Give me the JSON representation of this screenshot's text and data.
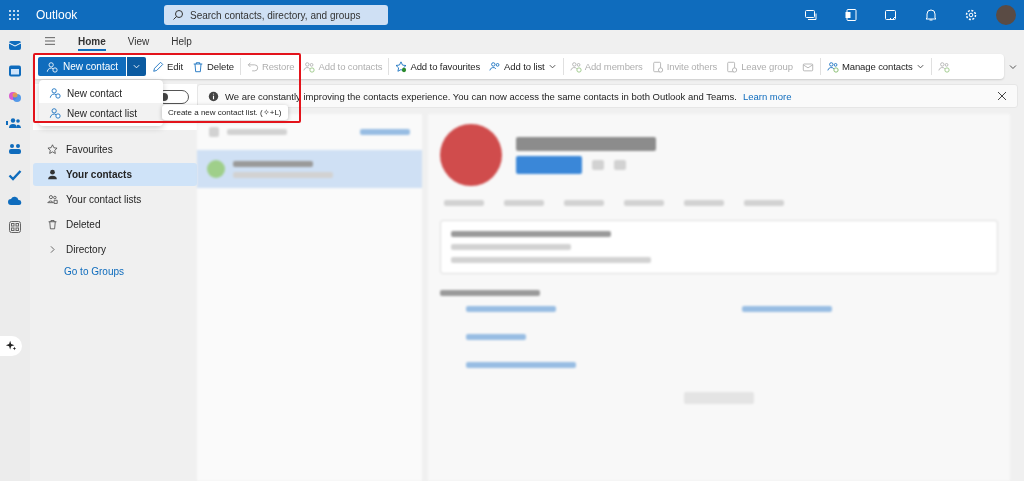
{
  "app": {
    "title": "Outlook",
    "search": {
      "placeholder": "Search contacts, directory, and groups"
    }
  },
  "ribbon_tabs": [
    {
      "label": "Home",
      "selected": true
    },
    {
      "label": "View",
      "selected": false
    },
    {
      "label": "Help",
      "selected": false
    }
  ],
  "toolbar": [
    {
      "kind": "split",
      "label": "New contact"
    },
    {
      "kind": "button",
      "label": "Edit",
      "disabled": false
    },
    {
      "kind": "button",
      "label": "Delete",
      "disabled": false
    },
    {
      "kind": "button",
      "label": "Restore",
      "disabled": true
    },
    {
      "kind": "button",
      "label": "Add to contacts",
      "disabled": true
    },
    {
      "kind": "button",
      "label": "Add to favourites",
      "disabled": false
    },
    {
      "kind": "dropdown",
      "label": "Add to list",
      "disabled": false
    },
    {
      "kind": "button",
      "label": "Add members",
      "disabled": true
    },
    {
      "kind": "button",
      "label": "Invite others",
      "disabled": true
    },
    {
      "kind": "button",
      "label": "Leave group",
      "disabled": true
    },
    {
      "kind": "icon",
      "disabled": true
    },
    {
      "kind": "dropdown",
      "label": "Manage contacts",
      "disabled": false
    },
    {
      "kind": "icon",
      "disabled": true
    }
  ],
  "new_menu": {
    "items": [
      {
        "label": "New contact",
        "selected": false
      },
      {
        "label": "New contact list",
        "selected": true
      }
    ],
    "tooltip": "Create a new contact list. (✧+L)"
  },
  "toggle": {
    "on": false
  },
  "info_bar": {
    "message": "We are constantly improving the contacts experience. You can now access the same contacts in both Outlook and Teams.",
    "link": "Learn more"
  },
  "nav": {
    "items": [
      {
        "label": "Favourites",
        "selected": false
      },
      {
        "label": "Your contacts",
        "selected": true
      },
      {
        "label": "Your contact lists",
        "selected": false
      },
      {
        "label": "Deleted",
        "selected": false
      },
      {
        "label": "Directory",
        "selected": false,
        "expanded": false
      }
    ],
    "link": "Go to Groups"
  }
}
